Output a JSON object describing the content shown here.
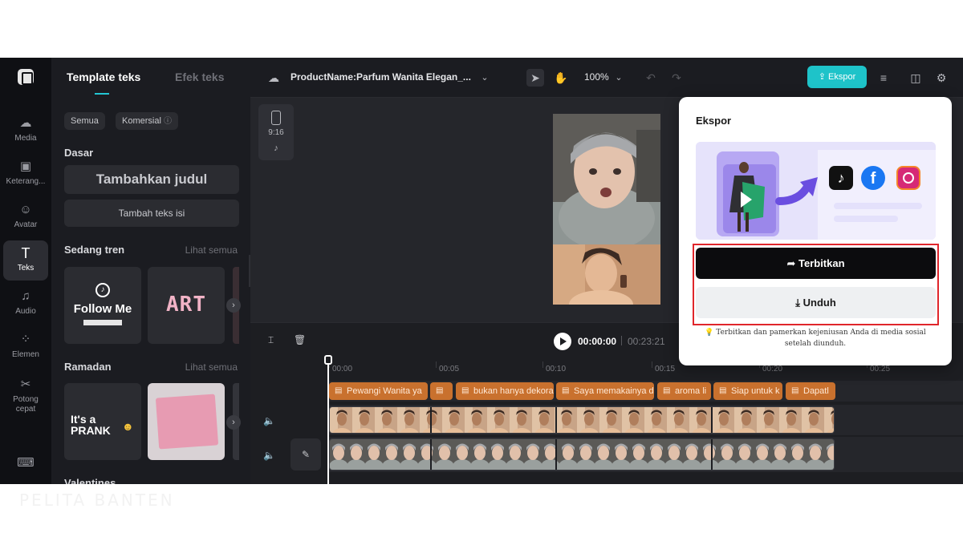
{
  "rail": {
    "items": [
      {
        "label": "Media",
        "icon": "cloud-upload-icon"
      },
      {
        "label": "Keterang...",
        "icon": "captions-icon"
      },
      {
        "label": "Avatar",
        "icon": "avatar-icon"
      },
      {
        "label": "Teks",
        "icon": "text-icon"
      },
      {
        "label": "Audio",
        "icon": "music-icon"
      },
      {
        "label": "Elemen",
        "icon": "elements-icon"
      },
      {
        "label": "Potong cepat",
        "icon": "scissors-icon"
      }
    ]
  },
  "panel": {
    "tabs": [
      "Template teks",
      "Efek teks"
    ],
    "chips": [
      "Semua",
      "Komersial"
    ],
    "basic_title": "Dasar",
    "add_title": "Tambahkan judul",
    "add_body": "Tambah teks isi",
    "trending_title": "Sedang tren",
    "see_all": "Lihat semua",
    "trending_templates": [
      "Follow Me",
      "ART"
    ],
    "ramadan_title": "Ramadan",
    "ramadan_templates": [
      "It's a PRANK"
    ],
    "valentine_title": "Valentines"
  },
  "topbar": {
    "project_name": "ProductName:Parfum Wanita Elegan_...",
    "zoom": "100%",
    "export_label": "Ekspor"
  },
  "canvas": {
    "ratio": "9:16"
  },
  "timeline": {
    "current_time": "00:00:00",
    "total_time": "00:23:21",
    "ruler": [
      "00:00",
      "00:05",
      "00:10",
      "00:15",
      "00:20",
      "00:25"
    ],
    "text_clips": [
      "Pewangi Wanita ya",
      "",
      "bukan hanya dekora",
      "Saya memakainya d",
      "aroma li",
      "Siap untuk k",
      "Dapatl"
    ]
  },
  "export_popup": {
    "title": "Ekspor",
    "publish_label": "Terbitkan",
    "download_label": "Unduh",
    "note": "Terbitkan dan pamerkan kejeniusan Anda di media sosial setelah diunduh."
  },
  "watermark": "PELITA BANTEN",
  "colors": {
    "accent": "#1ec3c9",
    "highlight": "#e0262b",
    "text_clip": "#c9712e"
  }
}
